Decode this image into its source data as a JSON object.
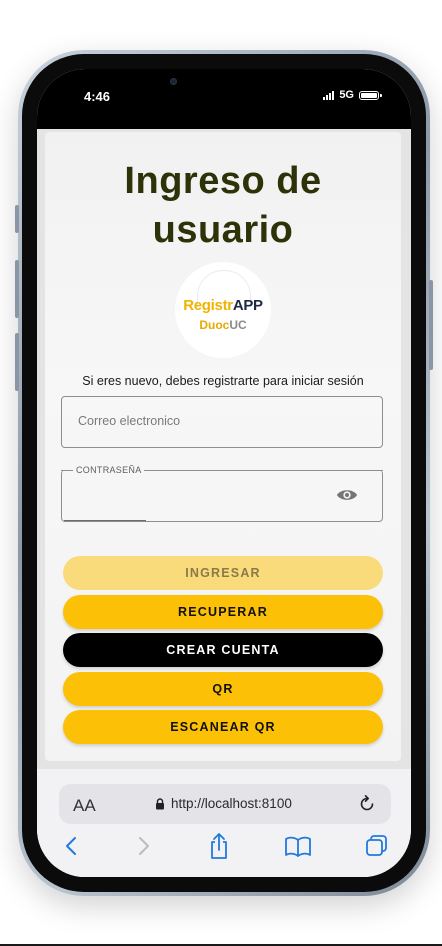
{
  "status_bar": {
    "time": "4:46",
    "network": "5G"
  },
  "app": {
    "title_line1": "Ingreso de",
    "title_line2": "usuario",
    "logo": {
      "part1": "Registr",
      "part2": "APP",
      "part3": "Duoc",
      "part4": "UC"
    },
    "subtitle": "Si eres nuevo, debes registrarte para iniciar sesión",
    "email_placeholder": "Correo electronico",
    "password_label": "CONTRASEÑA",
    "buttons": {
      "ingresar": "INGRESAR",
      "recuperar": "RECUPERAR",
      "crear_cuenta": "CREAR CUENTA",
      "qr": "QR",
      "escanear_qr": "ESCANEAR QR"
    }
  },
  "browser": {
    "text_size": "AA",
    "url": "http://localhost:8100"
  },
  "colors": {
    "primary": "#fcc006",
    "primary_disabled": "#fadb7b",
    "dark": "#000000",
    "title": "#2e3208",
    "ios_blue": "#1f7ae0"
  },
  "icons": [
    "eye-icon",
    "lock-icon",
    "reload-icon",
    "back-icon",
    "forward-icon",
    "share-icon",
    "bookmarks-icon",
    "tabs-icon"
  ]
}
